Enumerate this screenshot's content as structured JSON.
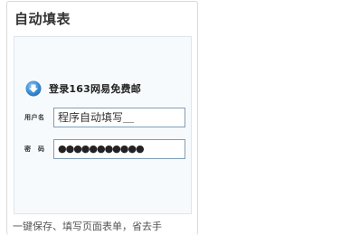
{
  "card": {
    "title": "自动填表",
    "description": "一键保存、填写页面表单，省去手"
  },
  "preview": {
    "login_title": "登录163网易免费邮",
    "arrow_icon": "down-arrow-circle-icon",
    "accent_color": "#3b8fd6",
    "username_label": "用户名",
    "username_value": "程序自动填写＿",
    "password_label": "密　码",
    "password_value": "●●●●●●●●●●●"
  }
}
